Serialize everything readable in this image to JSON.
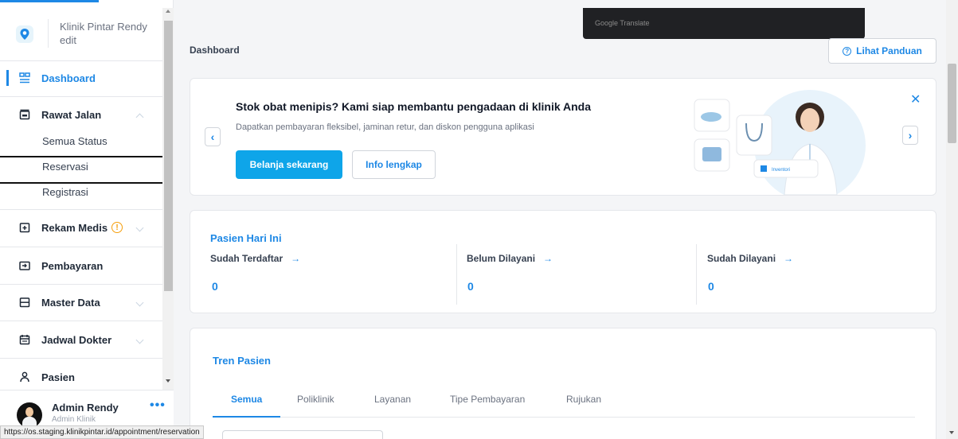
{
  "clinic": {
    "name": "Klinik Pintar Rendy",
    "edit_label": "edit"
  },
  "sidebar": {
    "items": [
      {
        "label": "Dashboard",
        "icon": "dashboard-icon",
        "active": true
      },
      {
        "label": "Rawat Jalan",
        "icon": "outpatient-icon",
        "expanded": true
      },
      {
        "label": "Rekam Medis",
        "icon": "medical-record-icon",
        "warning": "!"
      },
      {
        "label": "Pembayaran",
        "icon": "payment-icon"
      },
      {
        "label": "Master Data",
        "icon": "master-data-icon"
      },
      {
        "label": "Jadwal Dokter",
        "icon": "calendar-icon"
      },
      {
        "label": "Pasien",
        "icon": "patient-icon"
      }
    ],
    "subitems": [
      "Semua Status",
      "Reservasi",
      "Registrasi"
    ]
  },
  "user": {
    "name": "Admin Rendy",
    "role": "Admin Klinik",
    "menu": "•••"
  },
  "status_url": "https://os.staging.klinikpintar.id/appointment/reservation",
  "translate_bar": "Google Translate",
  "header": {
    "title": "Dashboard",
    "guide_button": "Lihat Panduan",
    "guide_icon": "?"
  },
  "promo": {
    "title": "Stok obat menipis? Kami siap membantu pengadaan di klinik Anda",
    "subtitle": "Dapatkan pembayaran fleksibel, jaminan retur, dan diskon pengguna aplikasi",
    "primary_button": "Belanja sekarang",
    "secondary_button": "Info lengkap",
    "prev": "‹",
    "next": "›",
    "close": "✕",
    "art_badge": "Inventori"
  },
  "today": {
    "title": "Pasien Hari Ini",
    "arrow": "→",
    "stats": [
      {
        "label": "Sudah Terdaftar",
        "value": "0"
      },
      {
        "label": "Belum Dilayani",
        "value": "0"
      },
      {
        "label": "Sudah Dilayani",
        "value": "0"
      }
    ]
  },
  "trend": {
    "title": "Tren Pasien",
    "tabs": [
      "Semua",
      "Poliklinik",
      "Layanan",
      "Tipe Pembayaran",
      "Rujukan"
    ],
    "active_tab": "Semua"
  },
  "colors": {
    "accent": "#1e88e5",
    "primary_button": "#0ea5e9",
    "warning": "#f59e0b"
  }
}
